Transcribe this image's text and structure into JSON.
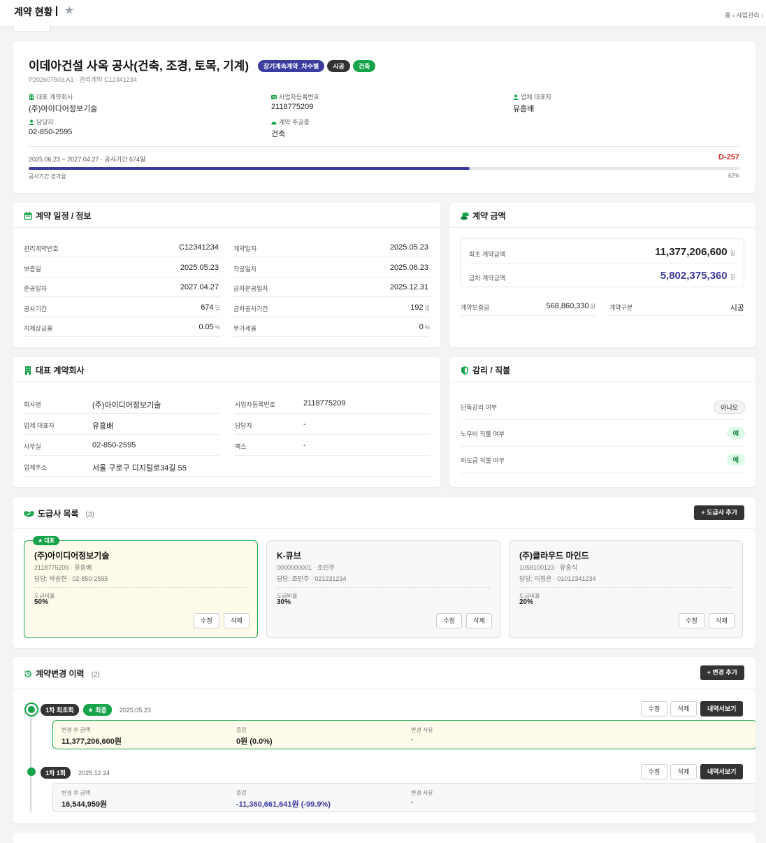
{
  "topbar": {
    "title": "계약 현황",
    "crumb_home": "홈",
    "crumb_biz": "사업관리"
  },
  "hero": {
    "title": "이데아건설 사옥 공사(건축, 조경, 토목, 기계)",
    "badges": [
      "장기계속계약_차수별",
      "시공",
      "건축"
    ],
    "subtitle": "P202607503.A1 · 관리계약 C12341234",
    "info": [
      {
        "label": "대표 계약회사",
        "value": "(주)아이디어정보기술"
      },
      {
        "label": "사업자등록번호",
        "value": "2118775209"
      },
      {
        "label": "업체 대표자",
        "value": "유흥배"
      },
      {
        "label": "담당자",
        "value": "02-850-2595"
      },
      {
        "label": "계약 주공종",
        "value": "건축"
      }
    ],
    "period": "2025.06.23 ~ 2027.04.27 · 공사기간 674일",
    "dday": "D-257",
    "progress_label": "공사기간 경과율",
    "progress_text": "62%",
    "progress_value": 0.62
  },
  "schedule": {
    "title": "계약 일정 / 정보",
    "rows": [
      {
        "k": "관리계약번호",
        "v": "C12341234",
        "u": ""
      },
      {
        "k": "계약일자",
        "v": "2025.05.23",
        "u": ""
      },
      {
        "k": "보증일",
        "v": "2025.05.23",
        "u": ""
      },
      {
        "k": "착공일자",
        "v": "2025.06.23",
        "u": ""
      },
      {
        "k": "준공일자",
        "v": "2027.04.27",
        "u": ""
      },
      {
        "k": "금차준공일자",
        "v": "2025.12.31",
        "u": ""
      },
      {
        "k": "공사기간",
        "v": "674",
        "u": "일"
      },
      {
        "k": "금차공사기간",
        "v": "192",
        "u": "일"
      },
      {
        "k": "지체상금율",
        "v": "0.05",
        "u": "%"
      },
      {
        "k": "부가세율",
        "v": "0",
        "u": "%"
      }
    ]
  },
  "amount": {
    "title": "계약 금액",
    "initial_label": "최초 계약금액",
    "initial_value": "11,377,206,600",
    "unit": "원",
    "current_label": "금차 계약금액",
    "current_value": "5,802,375,360",
    "deposit_label": "계약보증금",
    "deposit_value": "568,860,330",
    "type_label": "계약구분",
    "type_value": "시공"
  },
  "company": {
    "title": "대표 계약회사",
    "rows": [
      {
        "k": "회사명",
        "v": "(주)아이디어정보기술"
      },
      {
        "k": "사업자등록번호",
        "v": "2118775209"
      },
      {
        "k": "업체 대표자",
        "v": "유흥배"
      },
      {
        "k": "담당자",
        "v": "-"
      },
      {
        "k": "사무실",
        "v": "02-850-2595"
      },
      {
        "k": "팩스",
        "v": "-"
      },
      {
        "k": "업체주소",
        "v": "서울 구로구 디지털로34길 55"
      }
    ]
  },
  "audit": {
    "title": "감리 / 직불",
    "rows": [
      {
        "k": "단독감리 여부",
        "v": "아니오"
      },
      {
        "k": "노무비 직불 여부",
        "v": "예"
      },
      {
        "k": "하도급 직불 여부",
        "v": "예"
      }
    ]
  },
  "subs": {
    "title": "도급사 목록",
    "count": "(3)",
    "add_label": "+ 도급사 추가",
    "rep_label": "대표",
    "ratio_label": "도급비율",
    "edit_label": "수정",
    "delete_label": "삭제",
    "items": [
      {
        "name": "(주)아이디어정보기술",
        "line1": "2118775209  ·  유흥배",
        "line2": "담당: 박승현 · 02-850-2595",
        "ratio": "50%"
      },
      {
        "name": "K-큐브",
        "line1": "0000000001  ·  조민주",
        "line2": "담당: 조민주 · 021231234",
        "ratio": "30%"
      },
      {
        "name": "(주)클라우드 마인드",
        "line1": "1058100123  ·  유홍식",
        "line2": "담당: 이정운 · 01012341234",
        "ratio": "20%"
      }
    ]
  },
  "history": {
    "title": "계약변경 이력",
    "count": "(2)",
    "add_label": "+ 변경 추가",
    "edit_label": "수정",
    "delete_label": "삭제",
    "view_label": "내역서보기",
    "after_label": "변경 후 금액",
    "delta_label": "증감",
    "reason_label": "변경 사유",
    "latest_label": "최종",
    "items": [
      {
        "tag": "1차 최초회",
        "date": "2025.05.23",
        "after": "11,377,206,600원",
        "delta": "0원 (0.0%)",
        "reason": "-"
      },
      {
        "tag": "1차 1회",
        "date": "2025.12.24",
        "after": "16,544,959원",
        "delta": "-11,360,661,641원 (-99.9%)",
        "reason": "-"
      }
    ]
  },
  "colors": {
    "primary": "#3c3c9e",
    "green": "#16a34a",
    "dark": "#333333",
    "red": "#dc2626"
  }
}
